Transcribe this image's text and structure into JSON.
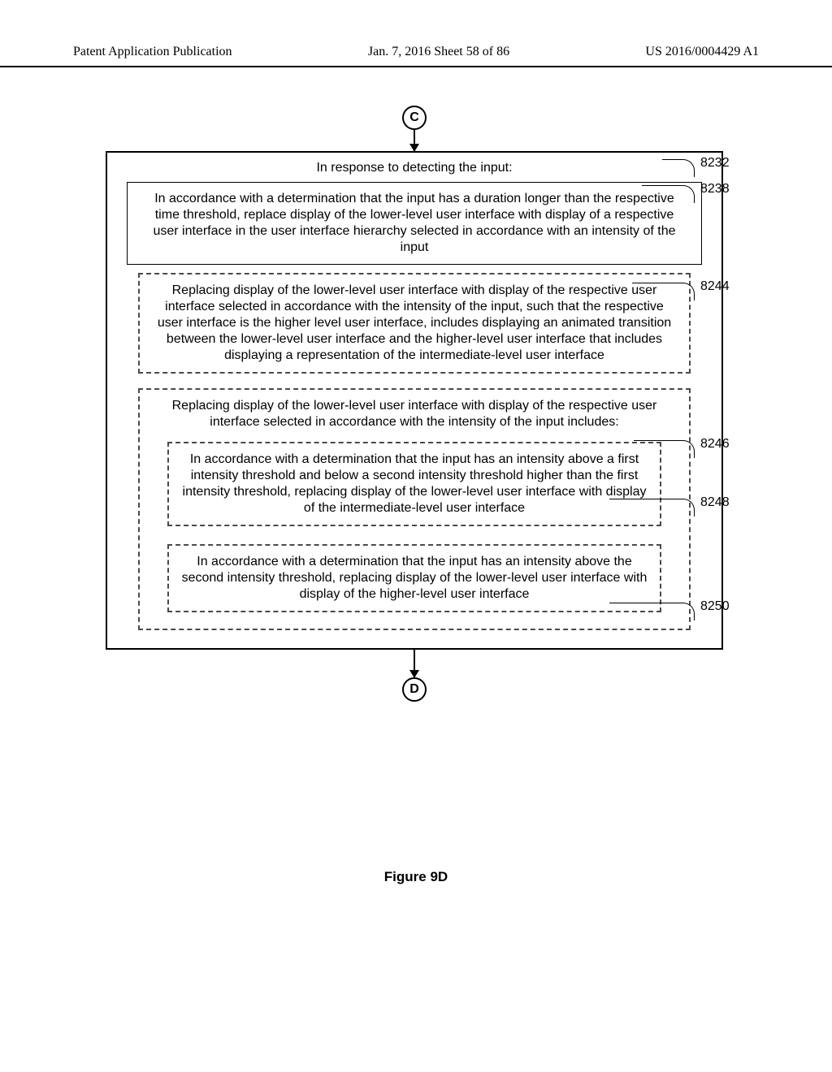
{
  "header": {
    "left": "Patent Application Publication",
    "center": "Jan. 7, 2016   Sheet 58 of 86",
    "right": "US 2016/0004429 A1"
  },
  "connectors": {
    "top": "C",
    "bottom": "D"
  },
  "boxes": {
    "b8232": {
      "title": "In response to detecting the input:",
      "ref": "8232"
    },
    "b8238": {
      "text": "In accordance with a determination that the input has a duration longer than the respective time threshold, replace display of the lower-level user interface with display of a respective user interface in the user interface hierarchy selected in accordance with an intensity of the input",
      "ref": "8238"
    },
    "b8244": {
      "text": "Replacing display of the lower-level user interface with display of the respective user interface selected in accordance with the intensity of the input, such that the respective user interface is the higher level user interface, includes displaying an animated transition between the lower-level user interface and the higher-level user interface that includes displaying a representation of the intermediate-level user interface",
      "ref": "8244"
    },
    "b8246": {
      "title": "Replacing display of the lower-level user interface with display of the respective user interface selected in accordance with the intensity of the input includes:",
      "ref": "8246"
    },
    "b8248": {
      "text": "In accordance with a determination that the input has an intensity above a first intensity threshold and below a second intensity threshold higher than the first intensity threshold, replacing display of the lower-level user interface with display of the intermediate-level user interface",
      "ref": "8248"
    },
    "b8250": {
      "text": "In accordance with a determination that the input has an intensity above the second intensity threshold, replacing display of the lower-level user interface with display of the higher-level user interface",
      "ref": "8250"
    }
  },
  "figure": "Figure 9D"
}
